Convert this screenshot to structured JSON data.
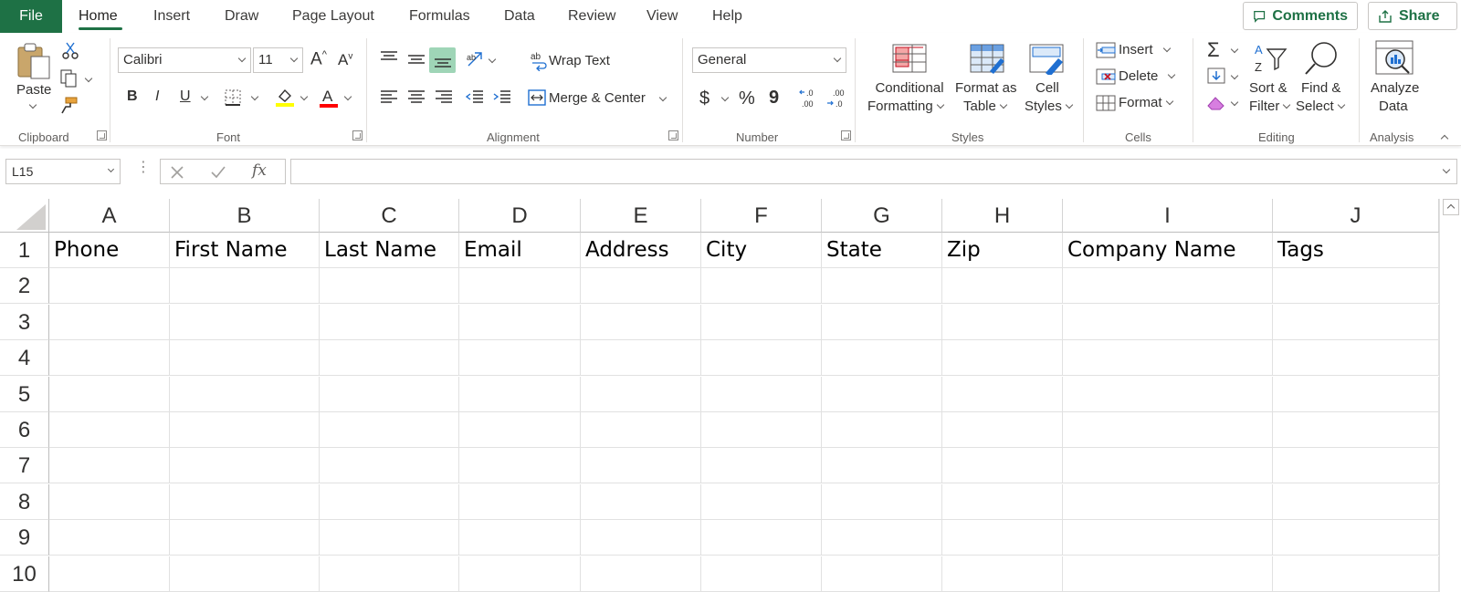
{
  "tabs": [
    "File",
    "Home",
    "Insert",
    "Draw",
    "Page Layout",
    "Formulas",
    "Data",
    "Review",
    "View",
    "Help"
  ],
  "header_buttons": {
    "comments": "Comments",
    "share": "Share"
  },
  "clipboard": {
    "paste": "Paste",
    "group": "Clipboard"
  },
  "font": {
    "family": "Calibri",
    "size": "11",
    "bold": "B",
    "italic": "I",
    "underline": "U",
    "group": "Font",
    "highlight_color": "#ffff00",
    "font_color": "#ff0000"
  },
  "alignment": {
    "wrap_text": "Wrap Text",
    "merge_center": "Merge & Center",
    "group": "Alignment"
  },
  "number": {
    "format": "General",
    "currency": "$",
    "percent": "%",
    "comma": "9",
    "inc_decimal": ".00",
    "dec_decimal": ".00",
    "inc_from": "←.0",
    "dec_to": "→.0",
    "group": "Number"
  },
  "styles": {
    "conditional": [
      "Conditional",
      "Formatting"
    ],
    "format_table": [
      "Format as",
      "Table"
    ],
    "cell_styles": [
      "Cell",
      "Styles"
    ],
    "group": "Styles"
  },
  "cells": {
    "insert": "Insert",
    "delete": "Delete",
    "format": "Format",
    "group": "Cells"
  },
  "editing": {
    "sort": [
      "Sort &",
      "Filter"
    ],
    "find": [
      "Find &",
      "Select"
    ],
    "group": "Editing"
  },
  "analysis": {
    "analyze": [
      "Analyze",
      "Data"
    ],
    "group": "Analysis"
  },
  "formula_bar": {
    "name_box": "L15",
    "fx": "fx",
    "formula": ""
  },
  "columns": [
    "A",
    "B",
    "C",
    "D",
    "E",
    "F",
    "G",
    "H",
    "I",
    "J"
  ],
  "rows": [
    "1",
    "2",
    "3",
    "4",
    "5",
    "6",
    "7",
    "8",
    "9",
    "10"
  ],
  "header_row": [
    "Phone",
    "First Name",
    "Last Name",
    "Email",
    "Address",
    "City",
    "State",
    "Zip",
    "Company Name",
    "Tags"
  ],
  "accent_color": "#1e7145"
}
